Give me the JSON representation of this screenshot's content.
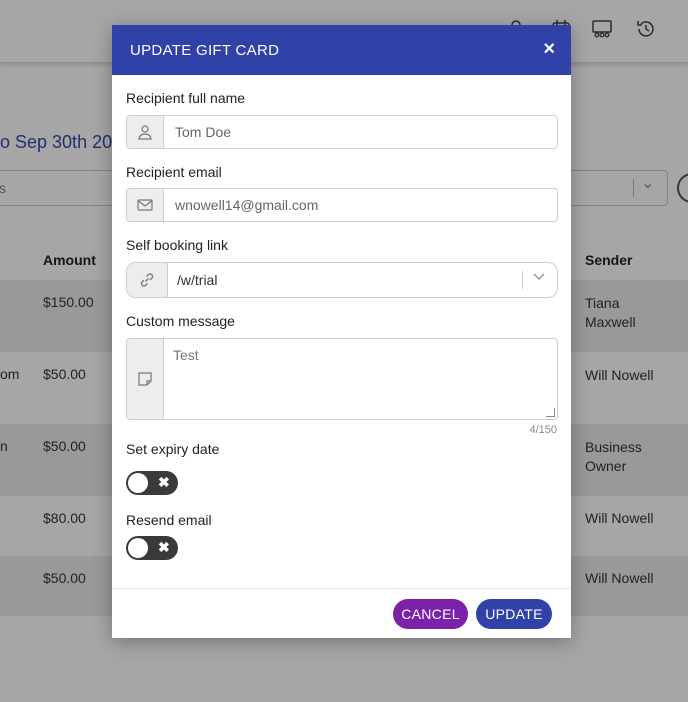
{
  "background": {
    "subtitle": "o Sep 30th 20",
    "filter_left_text": "s",
    "table_headers": {
      "amount": "Amount",
      "sender": "Sender"
    },
    "rows": [
      {
        "left": "",
        "amount": "$150.00",
        "sender": "Tiana Maxwell"
      },
      {
        "left": "om",
        "amount": "$50.00",
        "sender": "Will Nowell"
      },
      {
        "left": "n",
        "amount": "$50.00",
        "sender": "Business Owner"
      },
      {
        "left": "",
        "amount": "$80.00",
        "sender": "Will Nowell"
      },
      {
        "left": "",
        "amount": "$50.00",
        "sender": "Will Nowell"
      }
    ]
  },
  "modal": {
    "title": "UPDATE GIFT CARD",
    "close_label": "×",
    "recipient_name_label": "Recipient full name",
    "recipient_name_value": "Tom Doe",
    "recipient_email_label": "Recipient email",
    "recipient_email_value": "wnowell14@gmail.com",
    "booking_link_label": "Self booking link",
    "booking_link_value": "/w/trial",
    "custom_message_label": "Custom message",
    "custom_message_value": "Test",
    "char_counter": "4/150",
    "expiry_label": "Set expiry date",
    "resend_label": "Resend email",
    "cancel_label": "CANCEL",
    "update_label": "UPDATE"
  },
  "colors": {
    "header": "#3041a8",
    "cancel": "#7b22a8",
    "update": "#3041a8"
  }
}
